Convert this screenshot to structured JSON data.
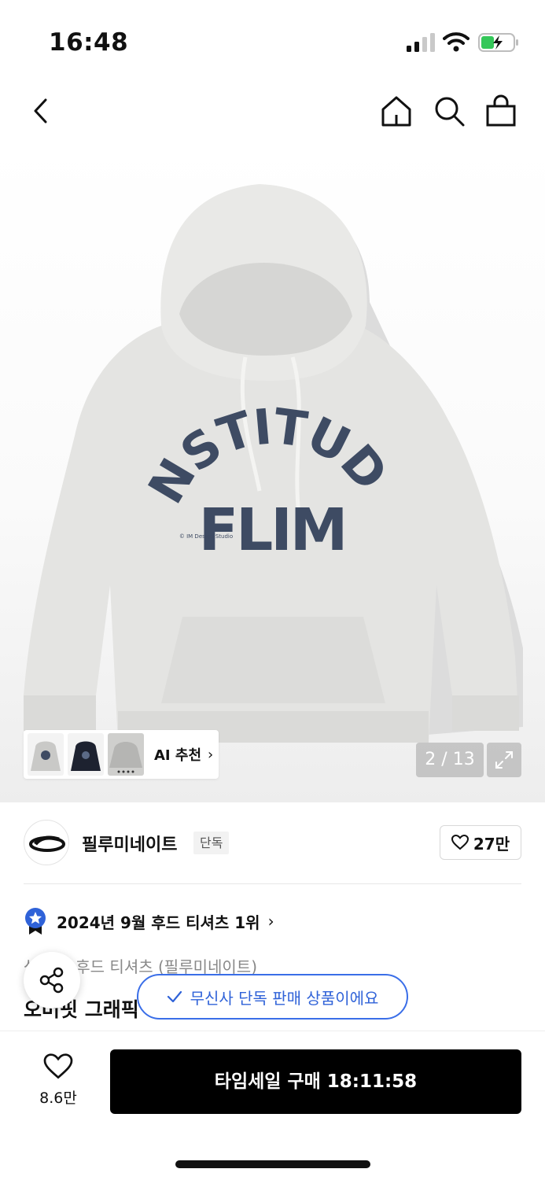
{
  "status_bar": {
    "time": "16:48"
  },
  "nav": {
    "back_icon": "chevron-left-icon",
    "home_icon": "home-icon",
    "search_icon": "search-icon",
    "cart_icon": "shopping-bag-icon"
  },
  "hero": {
    "print_text_line1": "INSTITUDE",
    "print_text_line2": "FLIM",
    "print_small": "© IM Design Studio",
    "ai_label": "AI 추천",
    "counter": "2 / 13"
  },
  "brand": {
    "name": "필루미네이트",
    "badge": "단독",
    "likes": "27만"
  },
  "ranking": {
    "text": "2024년 9월 후드 티셔츠 1위"
  },
  "product": {
    "category": "상의 > 후드 티셔츠 (필루미네이트)",
    "title": "오버핏 그래픽 후드 티셔츠"
  },
  "toast": {
    "text": "무신사 단독 판매 상품이에요"
  },
  "bottom": {
    "wish_count": "8.6만",
    "buy_label": "타임세일 구매 18:11:58"
  },
  "colors": {
    "accent_blue": "#2f62d8",
    "print_navy": "#3e4b63",
    "hoodie_gray": "#e3e3e1",
    "buy_button": "#000000"
  }
}
